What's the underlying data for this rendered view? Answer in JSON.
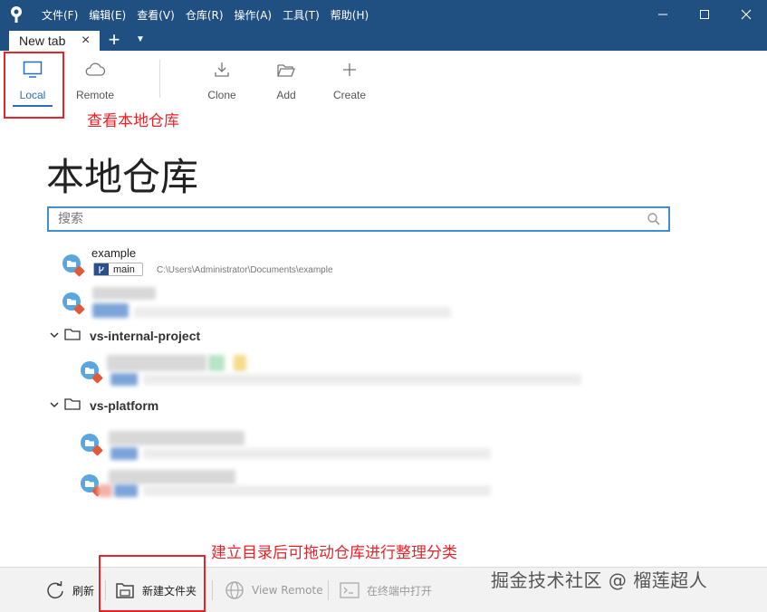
{
  "menu": [
    "文件(F)",
    "编辑(E)",
    "查看(V)",
    "仓库(R)",
    "操作(A)",
    "工具(T)",
    "帮助(H)"
  ],
  "tabs": [
    {
      "label": "New tab"
    }
  ],
  "toolbar": {
    "local": "Local",
    "remote": "Remote",
    "clone": "Clone",
    "add": "Add",
    "create": "Create"
  },
  "annotations": {
    "view_local": "查看本地仓库",
    "drag_tip": "建立目录后可拖动仓库进行整理分类"
  },
  "page_title": "本地仓库",
  "search": {
    "placeholder": "搜索",
    "value": ""
  },
  "repos": [
    {
      "name": "example",
      "branch": "main",
      "path": "C:\\Users\\Administrator\\Documents\\example"
    }
  ],
  "groups": [
    {
      "name": "vs-internal-project"
    },
    {
      "name": "vs-platform"
    }
  ],
  "bottom": {
    "refresh": "刷新",
    "new_folder": "新建文件夹",
    "view_remote": "View Remote",
    "open_terminal": "在终端中打开"
  },
  "watermark": "掘金技术社区 @ 榴莲超人",
  "colors": {
    "brand": "#205081",
    "accent": "#2a6fb8",
    "annotation": "#e8242a",
    "repo_badge": "#e05a3a"
  },
  "icons": {
    "logo": "sourcetree-logo-icon",
    "local": "monitor-icon",
    "remote": "cloud-icon",
    "clone": "download-icon",
    "add": "folder-open-icon",
    "create": "plus-icon",
    "search": "search-icon",
    "refresh": "refresh-icon",
    "new_folder": "new-folder-icon",
    "view_remote": "globe-icon",
    "terminal": "terminal-icon"
  }
}
